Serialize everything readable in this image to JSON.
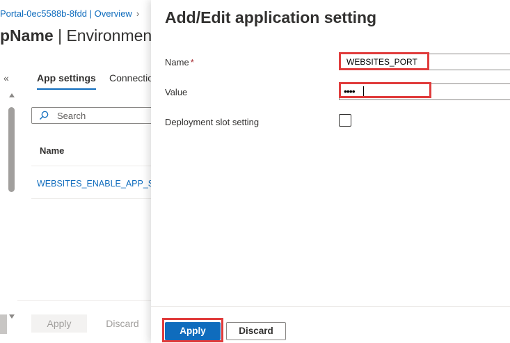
{
  "background": {
    "breadcrumb": "Portal-0ec5588b-8fdd | Overview",
    "breadcrumb_sep": "›",
    "title_bold": "pName",
    "title_rest": " | Environment",
    "collapse_icon": "«",
    "tabs": [
      {
        "label": "App settings",
        "selected": true
      },
      {
        "label": "Connectio",
        "selected": false
      }
    ],
    "search": {
      "placeholder": "Search"
    },
    "table": {
      "column": "Name",
      "rows": [
        "WEBSITES_ENABLE_APP_SERV"
      ]
    },
    "footer": {
      "apply_label": "Apply",
      "discard_label": "Discard"
    }
  },
  "panel": {
    "title": "Add/Edit application setting",
    "name_label": "Name",
    "required_marker": "*",
    "name_value": "WEBSITES_PORT",
    "value_label": "Value",
    "value_masked": "••••",
    "slot_label": "Deployment slot setting",
    "slot_checked": false,
    "apply_label": "Apply",
    "discard_label": "Discard"
  },
  "colors": {
    "accent": "#0f6cbd",
    "highlight": "#e03c3c",
    "required": "#a4262c"
  }
}
